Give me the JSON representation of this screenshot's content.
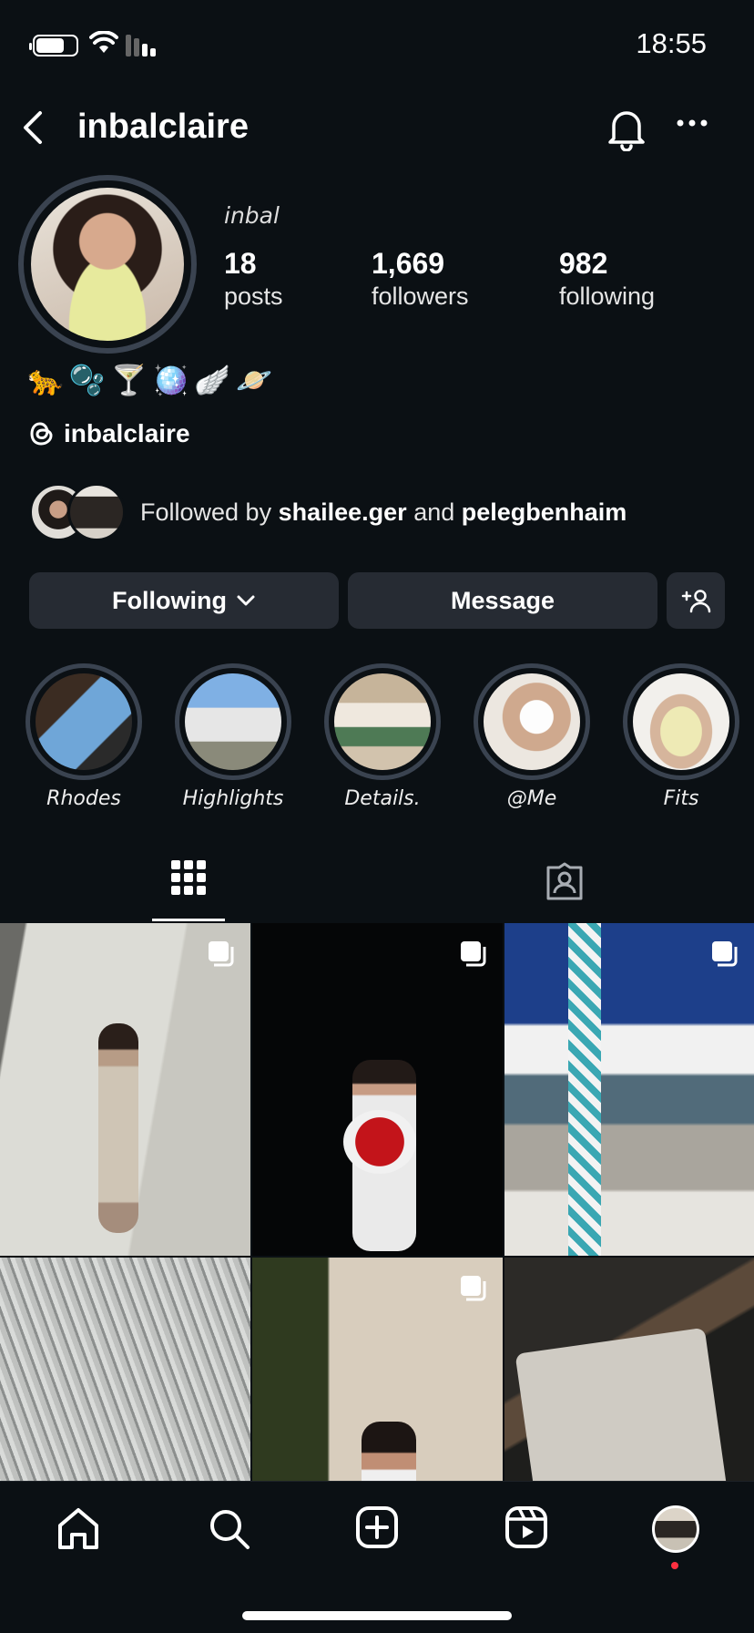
{
  "status_bar": {
    "time": "18:55"
  },
  "header": {
    "username": "inbalclaire"
  },
  "profile": {
    "display_name": "inbal",
    "stats": [
      {
        "value": "18",
        "label": "posts"
      },
      {
        "value": "1,669",
        "label": "followers"
      },
      {
        "value": "982",
        "label": "following"
      }
    ],
    "emoji_bio": "🐆🫧🍸🪩🪽🪐",
    "threads_handle": "inbalclaire",
    "followed_by": {
      "prefix": "Followed by",
      "user1": "shailee.ger",
      "conj": "and",
      "user2": "pelegbenhaim"
    }
  },
  "actions": {
    "following": "Following",
    "message": "Message"
  },
  "highlights": [
    {
      "label": "Rhodes"
    },
    {
      "label": "Highlights"
    },
    {
      "label": "Details."
    },
    {
      "label": "@Me"
    },
    {
      "label": "Fits"
    }
  ],
  "tabs": {
    "active": "posts-grid"
  },
  "colors": {
    "background": "#0b1014",
    "button": "#262b33",
    "ring": "#3a4350",
    "badge": "#ff3040"
  }
}
